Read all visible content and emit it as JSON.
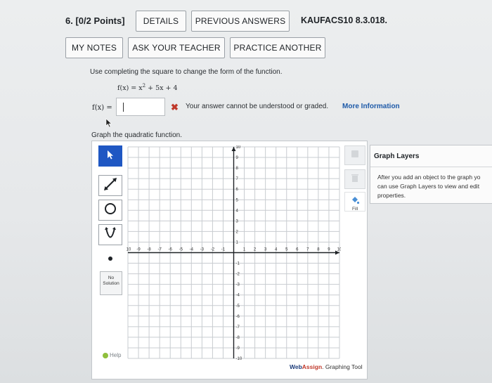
{
  "header": {
    "question_number": "6. [0/2 Points]",
    "details_label": "DETAILS",
    "previous_answers_label": "PREVIOUS ANSWERS",
    "reference": "KAUFACS10 8.3.018."
  },
  "actions": {
    "my_notes_label": "MY NOTES",
    "ask_teacher_label": "ASK YOUR TEACHER",
    "practice_another_label": "PRACTICE ANOTHER"
  },
  "question": {
    "prompt": "Use completing the square to change the form of the function.",
    "function_lhs": "f(x) = x",
    "function_exp": "2",
    "function_rhs": " + 5x + 4",
    "answer_label": "f(x) =",
    "answer_value": "",
    "error_message": "Your answer cannot be understood or graded.",
    "more_info_label": "More Information",
    "graph_prompt": "Graph the quadratic function."
  },
  "graph_tool": {
    "tools": [
      "pointer-icon",
      "line-icon",
      "circle-icon",
      "parabola-icon",
      "point-icon"
    ],
    "no_solution_line1": "No",
    "no_solution_line2": "Solution",
    "help_label": "Help",
    "fill_label": "Fill",
    "x_range": [
      -10,
      10
    ],
    "y_range": [
      -10,
      10
    ],
    "x_ticks": [
      "-10",
      "-9",
      "-8",
      "-7",
      "-6",
      "-5",
      "-4",
      "-3",
      "-2",
      "-1",
      "1",
      "2",
      "3",
      "4",
      "5",
      "6",
      "7",
      "8",
      "9",
      "10"
    ],
    "y_ticks": [
      "10",
      "9",
      "8",
      "7",
      "6",
      "5",
      "4",
      "3",
      "2",
      "1",
      "-1",
      "-2",
      "-3",
      "-4",
      "-5",
      "-6",
      "-7",
      "-8",
      "-9",
      "-10"
    ],
    "brand_web": "Web",
    "brand_assign": "Assign",
    "brand_rest": ". Graphing Tool"
  },
  "layers_panel": {
    "title": "Graph Layers",
    "body_line1": "After you add an object to the graph yo",
    "body_line2": "can use Graph Layers to view and edit",
    "body_line3": "properties."
  },
  "colors": {
    "active_tool": "#1f57c3",
    "error": "#c0392b",
    "link": "#1e5aa8",
    "grid_line": "#c8ccd0",
    "axis": "#1e2226"
  }
}
